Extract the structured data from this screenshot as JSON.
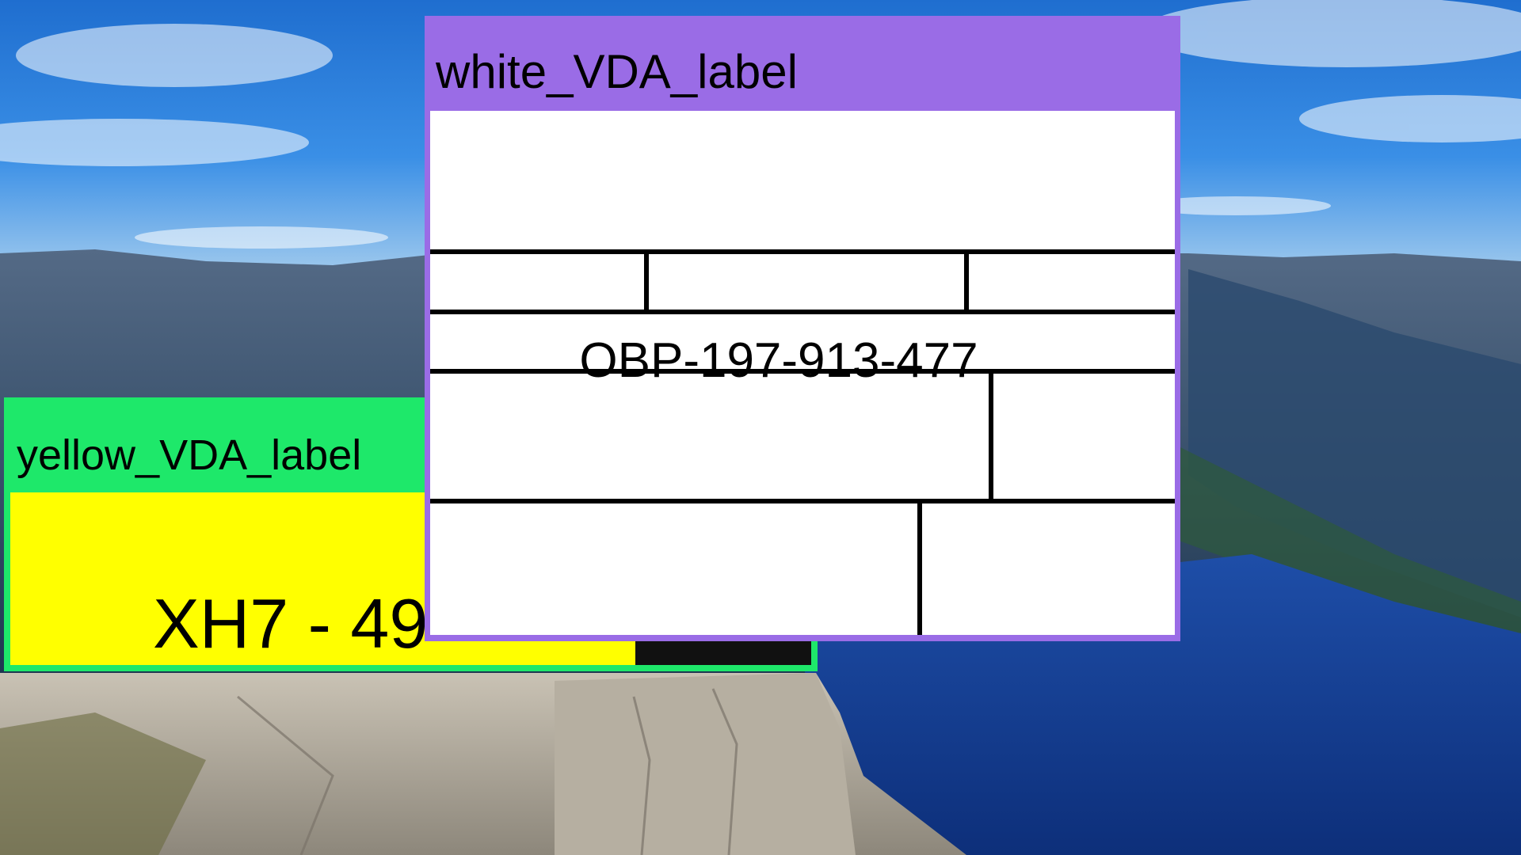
{
  "background": {
    "description_icon": "mountain-fjord-photo-icon"
  },
  "yellow_label": {
    "title": "yellow_VDA_label",
    "plate_text": "XH7 - 49",
    "frame_color": "#1ee86a",
    "body_color": "#ffff00"
  },
  "white_label": {
    "title": "white_VDA_label",
    "serial": "OBP-197-913-477",
    "frame_color": "#9a6ce6",
    "body_color": "#ffffff"
  }
}
